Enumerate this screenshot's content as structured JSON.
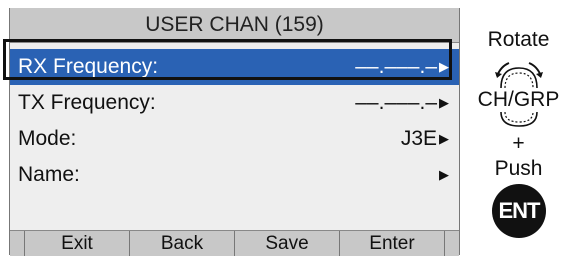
{
  "screen": {
    "title": "USER CHAN (159)",
    "rows": [
      {
        "label": "RX Frequency:",
        "value": "––.–––.–"
      },
      {
        "label": "TX Frequency:",
        "value": "––.–––.–"
      },
      {
        "label": "Mode:",
        "value": "J3E"
      },
      {
        "label": "Name:",
        "value": ""
      }
    ],
    "softkeys": [
      "Exit",
      "Back",
      "Save",
      "Enter"
    ],
    "selected_color": "#2a62b4"
  },
  "side": {
    "rotate": "Rotate",
    "knob_label": "CH/GRP",
    "plus": "+",
    "push": "Push",
    "ent": "ENT"
  }
}
